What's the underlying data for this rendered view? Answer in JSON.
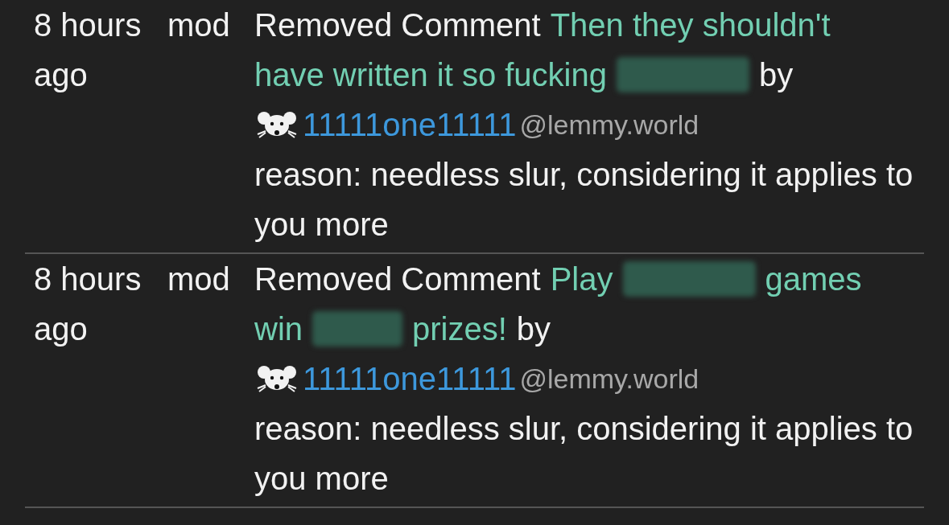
{
  "entries": [
    {
      "time": "8 hours ago",
      "role": "mod",
      "action": "Removed Comment",
      "comment": [
        {
          "kind": "text",
          "text": "Then they shouldn't"
        },
        {
          "kind": "text",
          "text": "have written it so fucking"
        },
        {
          "kind": "redacted_long"
        }
      ],
      "by": "by",
      "user": "11111one11111",
      "instance": "@lemmy.world",
      "reason": "reason: needless slur, considering it applies to you more"
    },
    {
      "time": "8 hours ago",
      "role": "mod",
      "action": "Removed Comment",
      "comment": [
        {
          "kind": "text",
          "text": "Play"
        },
        {
          "kind": "redacted_long"
        },
        {
          "kind": "text",
          "text": "games"
        },
        {
          "kind": "text",
          "text": "win"
        },
        {
          "kind": "redacted_short"
        },
        {
          "kind": "text",
          "text": "prizes!"
        }
      ],
      "by": "by",
      "user": "11111one11111",
      "instance": "@lemmy.world",
      "reason": "reason: needless slur, considering it applies to you more"
    }
  ]
}
